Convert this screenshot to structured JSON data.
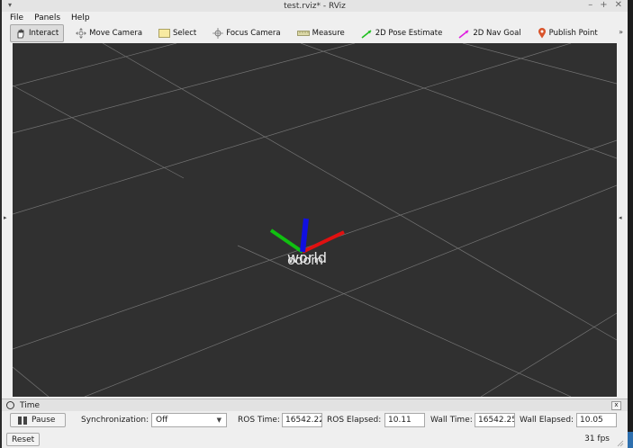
{
  "window": {
    "title": "test.rviz* - RViz",
    "controls": [
      "–",
      "+",
      "✕"
    ]
  },
  "menubar": {
    "file": "File",
    "panels": "Panels",
    "help": "Help"
  },
  "toolbar": {
    "interact": "Interact",
    "move_camera": "Move Camera",
    "select": "Select",
    "focus_camera": "Focus Camera",
    "measure": "Measure",
    "pose_estimate": "2D Pose Estimate",
    "nav_goal": "2D Nav Goal",
    "publish_point": "Publish Point",
    "more": "»"
  },
  "viewport": {
    "frame_label": "world",
    "frame_label_overlay": "odom",
    "background": "#303030",
    "grid_color": "#8a8a8a",
    "axis_colors": {
      "x": "#e01010",
      "y": "#10c010",
      "z": "#1010e0"
    }
  },
  "time_panel": {
    "title": "Time",
    "close": "x",
    "pause_label": "Pause",
    "sync_label": "Synchronization:",
    "sync_value": "Off",
    "ros_time_label": "ROS Time:",
    "ros_time_value": "16542.22",
    "ros_elapsed_label": "ROS Elapsed:",
    "ros_elapsed_value": "10.11",
    "wall_time_label": "Wall Time:",
    "wall_time_value": "16542.25",
    "wall_elapsed_label": "Wall Elapsed:",
    "wall_elapsed_value": "10.05"
  },
  "status": {
    "reset_label": "Reset",
    "fps": "31 fps"
  }
}
